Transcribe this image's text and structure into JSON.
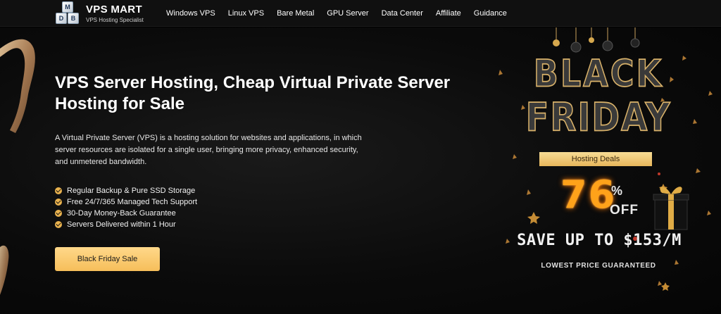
{
  "brand": {
    "name": "VPS MART",
    "tagline": "VPS Hosting Specialist",
    "logo_letters": [
      "M",
      "D",
      "B"
    ]
  },
  "nav": {
    "items": [
      {
        "label": "Windows VPS"
      },
      {
        "label": "Linux VPS"
      },
      {
        "label": "Bare Metal"
      },
      {
        "label": "GPU Server"
      },
      {
        "label": "Data Center"
      },
      {
        "label": "Affiliate"
      },
      {
        "label": "Guidance"
      }
    ]
  },
  "hero": {
    "headline": "VPS Server Hosting, Cheap Virtual Private Server Hosting for Sale",
    "description": "A Virtual Private Server (VPS) is a hosting solution for websites and applications, in which server resources are isolated for a single user, bringing more privacy, enhanced security, and unmetered bandwidth.",
    "features": [
      "Regular Backup & Pure SSD Storage",
      "Free 24/7/365 Managed Tech Support",
      "30-Day Money-Back Guarantee",
      "Servers Delivered within 1 Hour"
    ],
    "cta_label": "Black Friday Sale"
  },
  "promo": {
    "line1": "BLACK",
    "line2": "FRIDAY",
    "deals_label": "Hosting Deals",
    "percent": "76",
    "percent_sign": "%",
    "off": "OFF",
    "save": "SAVE UP TO $153/M",
    "guarantee": "LOWEST PRICE GUARANTEED"
  },
  "colors": {
    "accent_gold": "#f6be5a",
    "nav_bg": "#101010",
    "hero_bg": "#0b0b0b",
    "percent_orange": "#ffa21a"
  },
  "icons": {
    "feature_bullet": "check-circle-icon",
    "gift": "gift-box-icon"
  }
}
